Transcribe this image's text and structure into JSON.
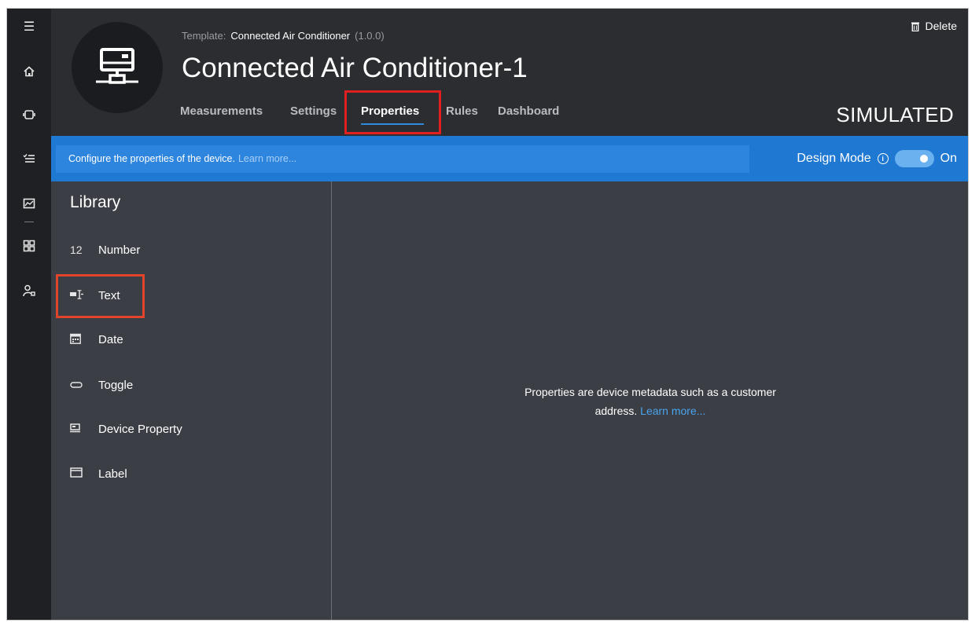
{
  "rail": {
    "items": [
      {
        "name": "menu",
        "glyph": "☰"
      },
      {
        "name": "home",
        "glyph": "⌂"
      },
      {
        "name": "devices",
        "glyph": "▢"
      },
      {
        "name": "rules",
        "glyph": "≡"
      },
      {
        "name": "analytics",
        "glyph": "▣"
      },
      {
        "name": "dashboards",
        "glyph": "⊞"
      },
      {
        "name": "admin",
        "glyph": "♙"
      }
    ]
  },
  "header": {
    "template_label": "Template:",
    "template_name": "Connected Air Conditioner",
    "template_version": "(1.0.0)",
    "device_title": "Connected Air Conditioner-1",
    "delete_label": "Delete",
    "status": "SIMULATED",
    "tabs": [
      {
        "label": "Measurements"
      },
      {
        "label": "Settings"
      },
      {
        "label": "Properties"
      },
      {
        "label": "Rules"
      },
      {
        "label": "Dashboard"
      }
    ],
    "active_tab": "Properties"
  },
  "banner": {
    "message": "Configure the properties of the device.",
    "learn_more": "Learn more...",
    "design_mode_label": "Design Mode",
    "toggle_state": "On"
  },
  "library": {
    "title": "Library",
    "items": [
      {
        "icon": "12",
        "label": "Number"
      },
      {
        "icon": "▭",
        "label": "Text"
      },
      {
        "icon": "▦",
        "label": "Date"
      },
      {
        "icon": "⬭",
        "label": "Toggle"
      },
      {
        "icon": "▭",
        "label": "Device Property"
      },
      {
        "icon": "▭",
        "label": "Label"
      }
    ]
  },
  "canvas": {
    "empty_line1": "Properties are device metadata such as a customer",
    "empty_line2": "address.",
    "empty_link": "Learn more..."
  },
  "colors": {
    "accent": "#1f78d1",
    "highlight": "#e02020",
    "panel": "#3b3e45",
    "rail": "#1f2023"
  }
}
